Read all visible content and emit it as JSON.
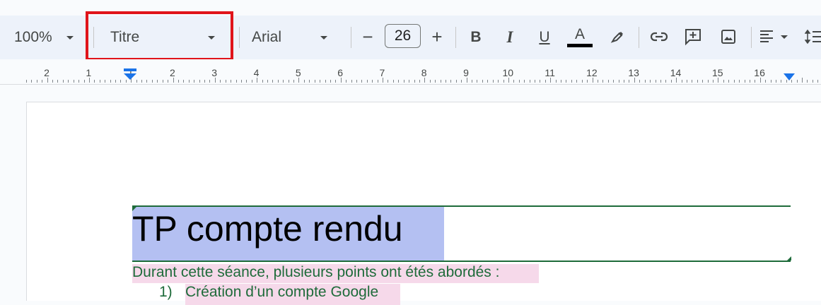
{
  "toolbar": {
    "zoom": "100%",
    "style": "Titre",
    "font": "Arial",
    "font_size": "26",
    "minus_label": "−",
    "plus_label": "+",
    "bold_label": "B",
    "italic_label": "I",
    "underline_label": "U",
    "text_color_label": "A",
    "icons": [
      "link-icon",
      "add-comment-icon",
      "image-icon",
      "align-left-icon",
      "line-spacing-icon"
    ]
  },
  "ruler": {
    "labels": [
      "2",
      "1",
      "1",
      "2",
      "3",
      "4",
      "5",
      "6",
      "7",
      "8",
      "9",
      "10",
      "11",
      "12",
      "13",
      "14",
      "15",
      "16"
    ]
  },
  "document": {
    "title": "TP compte rendu",
    "paragraph": "Durant cette séance, plusieurs points ont étés abordés :",
    "list": [
      {
        "num": "1)",
        "text": "Création d’un compte Google"
      }
    ]
  },
  "colors": {
    "highlight_box": "#e0141a",
    "title_highlight": "#b4c0f2",
    "text_highlight": "#f6d9ea",
    "green_text": "#1e6b3a"
  }
}
